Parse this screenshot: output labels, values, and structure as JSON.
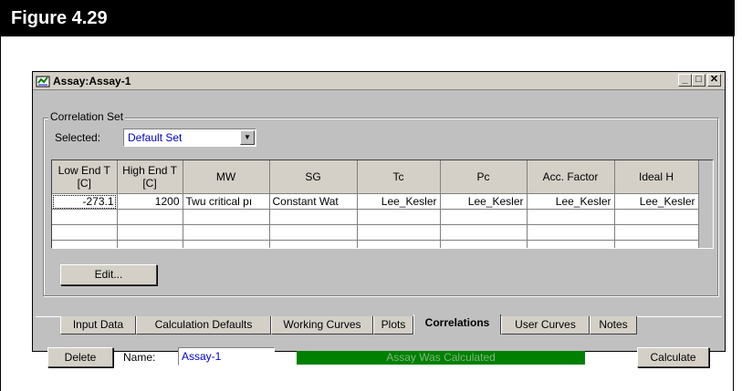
{
  "figure": {
    "title": "Figure 4.29"
  },
  "window": {
    "title": "Assay:Assay-1",
    "minimize": "_",
    "maximize": "□",
    "close": "✕"
  },
  "correlation_set": {
    "group_label": "Correlation Set",
    "selected_label": "Selected:",
    "selected_value": "Default Set"
  },
  "grid": {
    "headers": [
      "Low End T\n[C]",
      "High End T\n[C]",
      "MW",
      "SG",
      "Tc",
      "Pc",
      "Acc. Factor",
      "Ideal H"
    ],
    "rows": [
      [
        "-273.1",
        "1200",
        "Twu critical pı",
        "Constant Wat",
        "Lee_Kesler",
        "Lee_Kesler",
        "Lee_Kesler",
        "Lee_Kesler"
      ],
      [
        "",
        "",
        "",
        "",
        "",
        "",
        "",
        ""
      ],
      [
        "",
        "",
        "",
        "",
        "",
        "",
        "",
        ""
      ],
      [
        "",
        "",
        "",
        "",
        "",
        "",
        "",
        ""
      ]
    ]
  },
  "buttons": {
    "edit": "Edit...",
    "delete": "Delete",
    "calculate": "Calculate"
  },
  "tabs": [
    "Input Data",
    "Calculation Defaults",
    "Working Curves",
    "Plots",
    "Correlations",
    "User Curves",
    "Notes"
  ],
  "active_tab": "Correlations",
  "name_field": {
    "label": "Name:",
    "value": "Assay-1"
  },
  "status": {
    "text": "Assay Was Calculated",
    "color": "#008000"
  }
}
